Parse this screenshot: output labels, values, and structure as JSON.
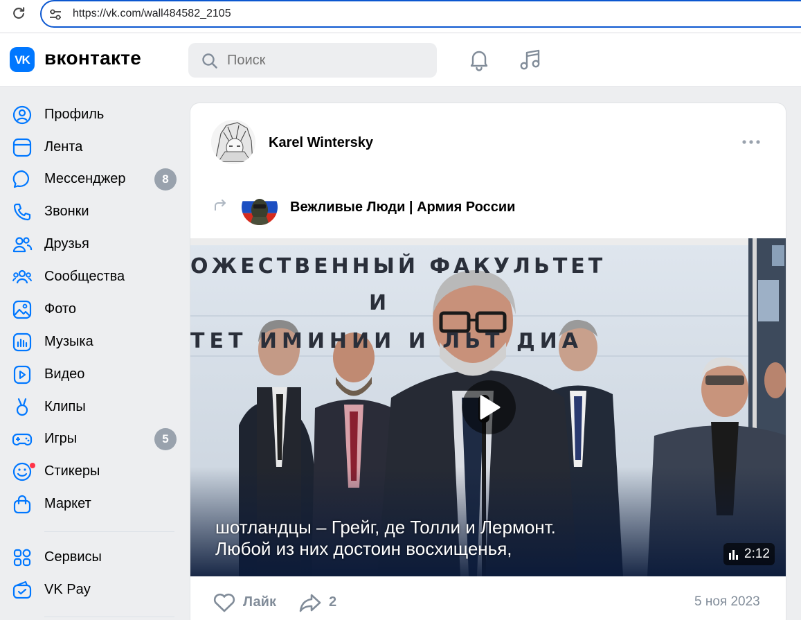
{
  "browser": {
    "url": "https://vk.com/wall484582_2105"
  },
  "header": {
    "logo_text": "VK",
    "wordmark": "вконтакте",
    "search_placeholder": "Поиск",
    "accent_color": "#0077ff"
  },
  "sidebar": {
    "items": [
      {
        "label": "Профиль",
        "icon": "profile-icon"
      },
      {
        "label": "Лента",
        "icon": "feed-icon"
      },
      {
        "label": "Мессенджер",
        "icon": "messenger-icon",
        "badge": "8"
      },
      {
        "label": "Звонки",
        "icon": "phone-icon"
      },
      {
        "label": "Друзья",
        "icon": "friends-icon"
      },
      {
        "label": "Сообщества",
        "icon": "communities-icon"
      },
      {
        "label": "Фото",
        "icon": "photo-icon"
      },
      {
        "label": "Музыка",
        "icon": "music-icon"
      },
      {
        "label": "Видео",
        "icon": "video-icon"
      },
      {
        "label": "Клипы",
        "icon": "clips-icon"
      },
      {
        "label": "Игры",
        "icon": "games-icon",
        "badge": "5"
      },
      {
        "label": "Стикеры",
        "icon": "stickers-icon"
      },
      {
        "label": "Маркет",
        "icon": "market-icon"
      },
      {
        "label": "Сервисы",
        "icon": "services-icon"
      },
      {
        "label": "VK Pay",
        "icon": "vkpay-icon"
      }
    ]
  },
  "post": {
    "author": "Karel Wintersky",
    "repost_source": "Вежливые Люди | Армия России",
    "video": {
      "banner_line1": "ОЖЕСТВЕННЫЙ ФАКУЛЬТЕТ",
      "banner_line2": "И",
      "banner_line3": "ТЕТ ИМИНИИ И ЛЬТ ДИА",
      "subtitle_line1": "шотландцы – Грейг, де Толли и Лермонт.",
      "subtitle_line2": "Любой из них достоин восхищенья,",
      "duration": "2:12"
    },
    "like_label": "Лайк",
    "share_count": "2",
    "date": "5 ноя 2023"
  }
}
